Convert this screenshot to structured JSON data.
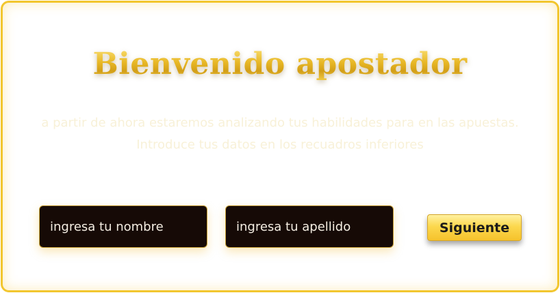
{
  "header": {
    "title": "Bienvenido apostador",
    "subtitle": "a partir de ahora estaremos analizando tus habilidades para en las apuestas. Introduce tus datos en los recuadros inferiores"
  },
  "form": {
    "first_name_placeholder": "ingresa tu nombre",
    "last_name_placeholder": "ingresa tu apellido",
    "next_label": "Siguiente"
  },
  "colors": {
    "accent_gold": "#f2c62e",
    "field_background": "#160a06",
    "button_gold": "#fcd84e"
  }
}
